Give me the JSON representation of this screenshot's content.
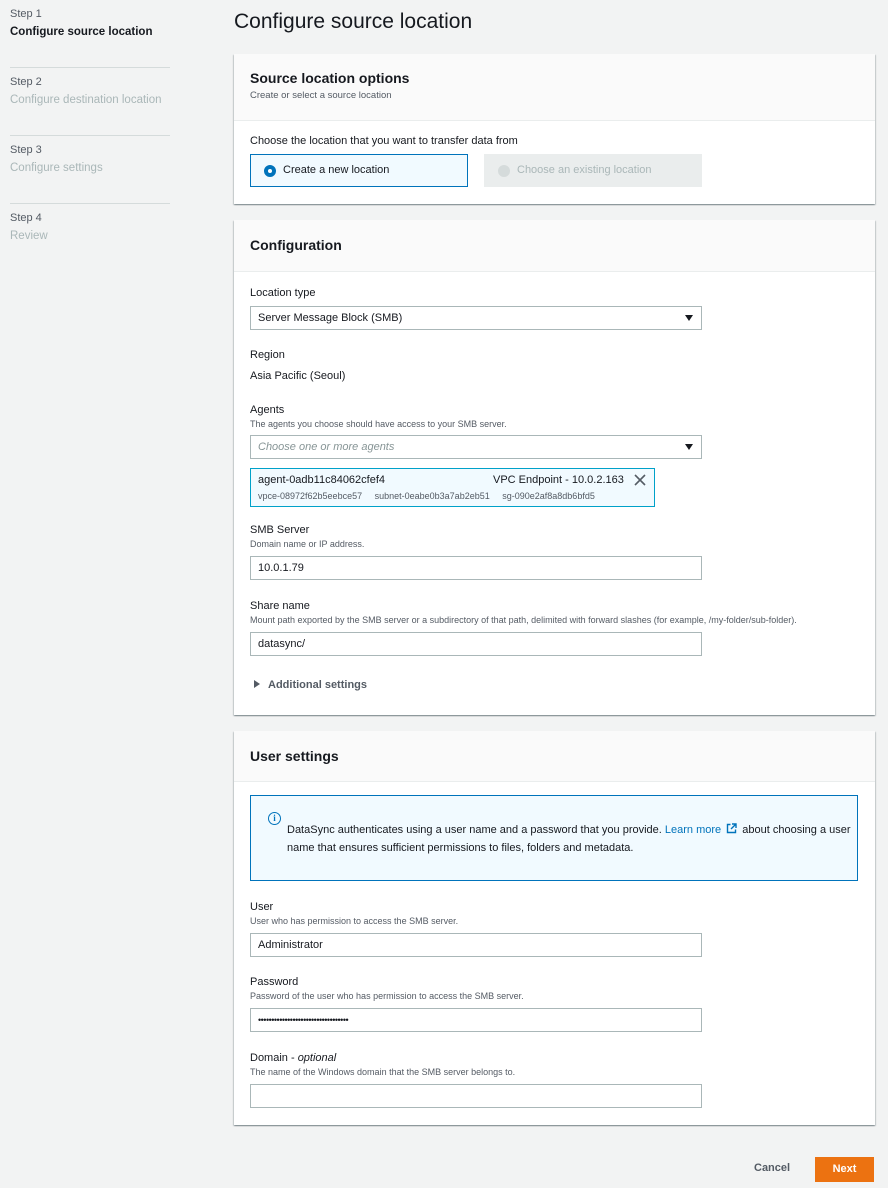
{
  "steps": [
    {
      "num": "Step 1",
      "title": "Configure source location"
    },
    {
      "num": "Step 2",
      "title": "Configure destination location"
    },
    {
      "num": "Step 3",
      "title": "Configure settings"
    },
    {
      "num": "Step 4",
      "title": "Review"
    }
  ],
  "page_title": "Configure source location",
  "source_panel": {
    "title": "Source location options",
    "description": "Create or select a source location",
    "question": "Choose the location that you want to transfer data from",
    "option_new": "Create a new location",
    "option_existing": "Choose an existing location"
  },
  "config_panel": {
    "title": "Configuration",
    "location_type_label": "Location type",
    "location_type_value": "Server Message Block (SMB)",
    "region_label": "Region",
    "region_value": "Asia Pacific (Seoul)",
    "agents_label": "Agents",
    "agents_desc": "The agents you choose should have access to your SMB server.",
    "agents_placeholder": "Choose one or more agents",
    "agent_token": {
      "name": "agent-0adb11c84062cfef4",
      "endpoint": "VPC Endpoint - 10.0.2.163",
      "vpce": "vpce-08972f62b5eebce57",
      "subnet": "subnet-0eabe0b3a7ab2eb51",
      "sg": "sg-090e2af8a8db6bfd5"
    },
    "smb_server_label": "SMB Server",
    "smb_server_desc": "Domain name or IP address.",
    "smb_server_value": "10.0.1.79",
    "share_name_label": "Share name",
    "share_name_desc": "Mount path exported by the SMB server or a subdirectory of that path, delimited with forward slashes (for example, /my-folder/sub-folder).",
    "share_name_value": "datasync/",
    "additional_settings": "Additional settings"
  },
  "user_panel": {
    "title": "User settings",
    "info_text_before": "DataSync authenticates using a user name and a password that you provide.",
    "info_link": "Learn more",
    "info_text_after": "about choosing a user name that ensures sufficient permissions to files, folders and metadata.",
    "user_label": "User",
    "user_desc": "User who has permission to access the SMB server.",
    "user_value": "Administrator",
    "password_label": "Password",
    "password_desc": "Password of the user who has permission to access the SMB server.",
    "password_value": "••••••••••••••••••••••••••••••••••",
    "domain_label": "Domain - ",
    "domain_optional": "optional",
    "domain_desc": "The name of the Windows domain that the SMB server belongs to.",
    "domain_value": ""
  },
  "footer": {
    "cancel": "Cancel",
    "next": "Next"
  },
  "colors": {
    "accent": "#0073bb",
    "primary_button": "#ec7211",
    "token_border": "#00a1c9"
  }
}
